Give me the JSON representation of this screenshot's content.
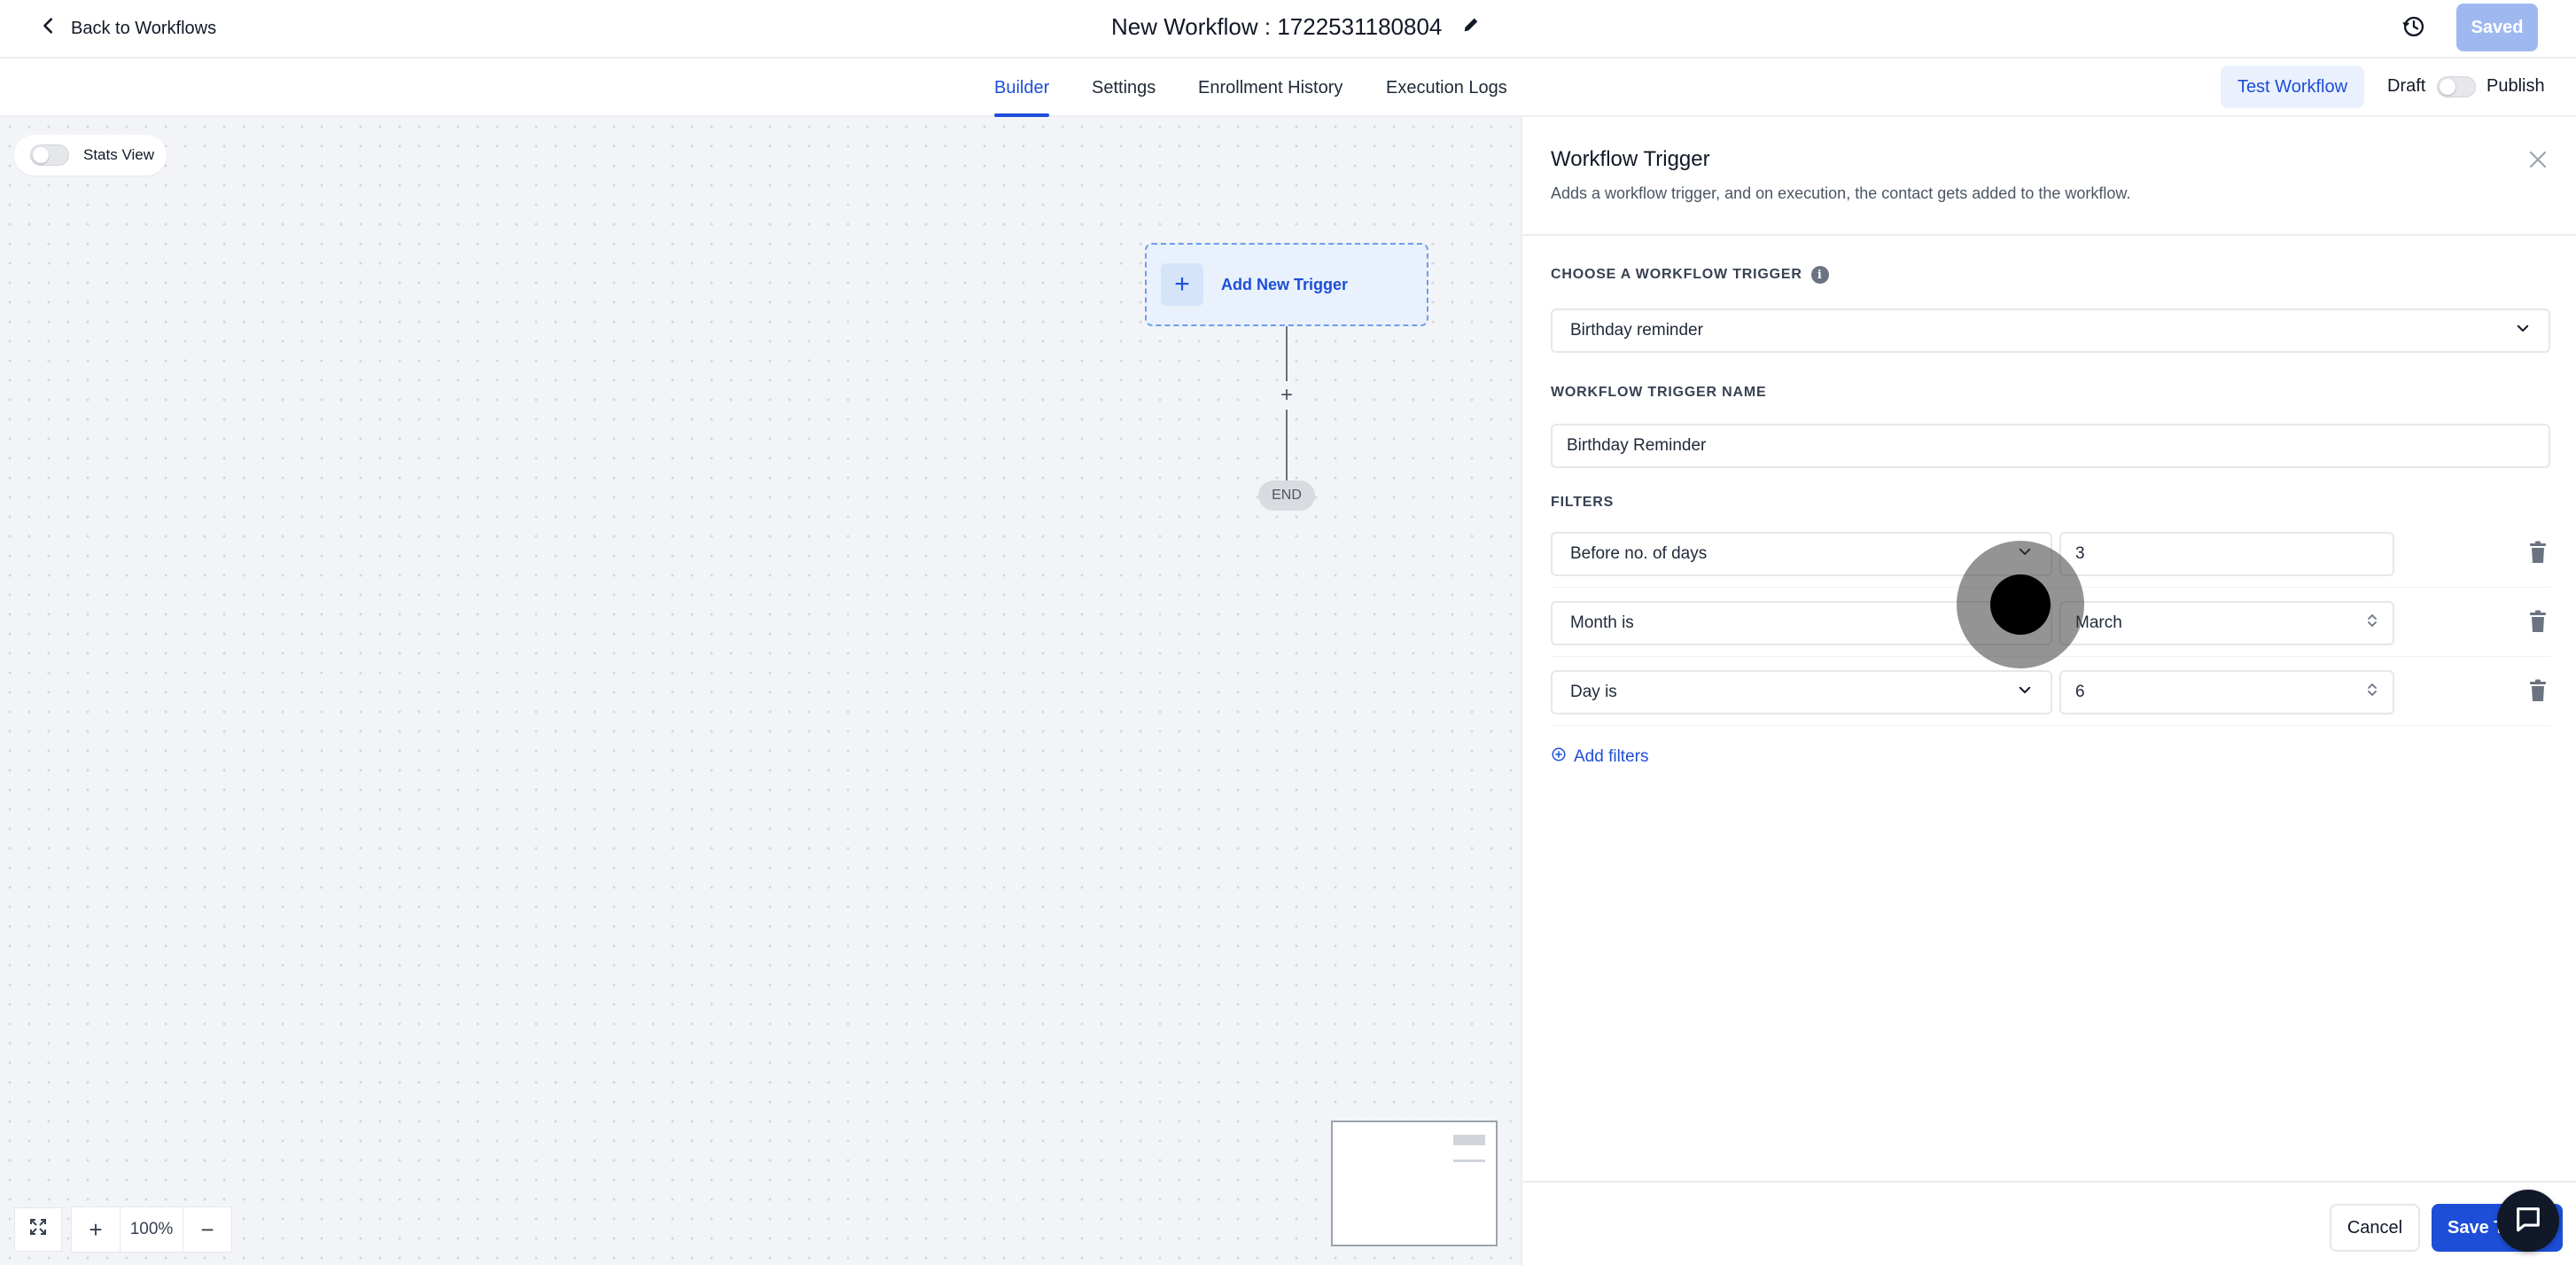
{
  "header": {
    "back_label": "Back to Workflows",
    "workflow_title": "New Workflow : 1722531180804",
    "saved_label": "Saved"
  },
  "tabs": [
    {
      "label": "Builder",
      "active": true
    },
    {
      "label": "Settings",
      "active": false
    },
    {
      "label": "Enrollment History",
      "active": false
    },
    {
      "label": "Execution Logs",
      "active": false
    }
  ],
  "actions": {
    "test_label": "Test Workflow",
    "draft_label": "Draft",
    "publish_label": "Publish",
    "publish_enabled": false
  },
  "canvas": {
    "stats_label": "Stats View",
    "stats_enabled": false,
    "add_trigger_label": "Add New Trigger",
    "add_step_symbol": "+",
    "end_label": "END",
    "zoom_level": "100%"
  },
  "panel": {
    "title": "Workflow Trigger",
    "subtitle": "Adds a workflow trigger, and on execution, the contact gets added to the workflow.",
    "trigger_section_label": "CHOOSE A WORKFLOW TRIGGER",
    "trigger_selected": "Birthday reminder",
    "name_section_label": "WORKFLOW TRIGGER NAME",
    "name_value": "Birthday Reminder",
    "filters_section_label": "FILTERS",
    "filters": [
      {
        "field": "Before no. of days",
        "value": "3"
      },
      {
        "field": "Month is",
        "value": "March"
      },
      {
        "field": "Day is",
        "value": "6"
      }
    ],
    "add_filters_label": "Add filters",
    "cancel_label": "Cancel",
    "save_label": "Save Trigger"
  },
  "colors": {
    "accent": "#1d4ed8",
    "canvas_bg": "#f3f4f7",
    "saved_disabled": "#9fb9f0"
  },
  "icons": {
    "back": "chevron-left-icon",
    "edit": "pencil-icon",
    "history": "history-icon",
    "info": "info-icon",
    "dropdown": "chevron-down-icon",
    "stepper": "chevron-up-down-icon",
    "delete": "trash-icon",
    "add": "plus-circle-icon",
    "close": "close-icon",
    "chat": "chat-icon",
    "fit": "fit-screen-icon"
  }
}
